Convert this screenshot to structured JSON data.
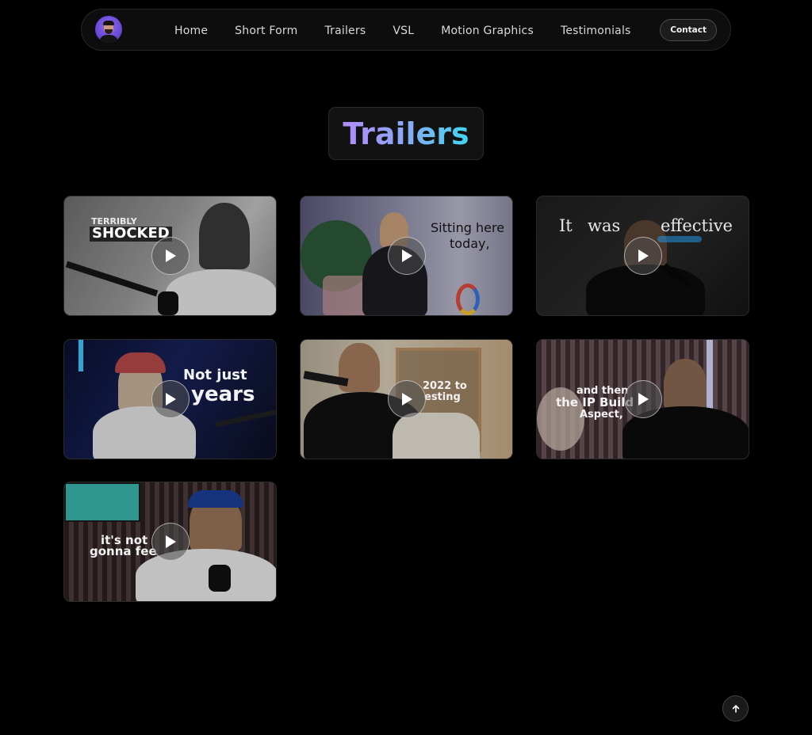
{
  "nav": {
    "links": [
      "Home",
      "Short Form",
      "Trailers",
      "VSL",
      "Motion Graphics",
      "Testimonials"
    ],
    "contact_label": "Contact"
  },
  "page_title": "Trailers",
  "videos": [
    {
      "caption_lines": [
        "TERRIBLY",
        "SHOCKED"
      ],
      "icon": "play-icon"
    },
    {
      "caption_lines": [
        "Sitting here",
        "today,"
      ],
      "icon": "play-icon"
    },
    {
      "caption_lines": [
        "It",
        "was",
        "effective"
      ],
      "icon": "play-icon"
    },
    {
      "caption_lines": [
        "Not just",
        "years"
      ],
      "icon": "play-icon"
    },
    {
      "caption_lines": [
        "2022 to",
        "esting"
      ],
      "icon": "play-icon"
    },
    {
      "caption_lines": [
        "and then",
        "the IP Build",
        "Aspect,"
      ],
      "icon": "play-icon"
    },
    {
      "caption_lines": [
        "it's not",
        "gonna fee"
      ],
      "icon": "play-icon"
    }
  ],
  "scroll_top_icon": "arrow-up-icon"
}
